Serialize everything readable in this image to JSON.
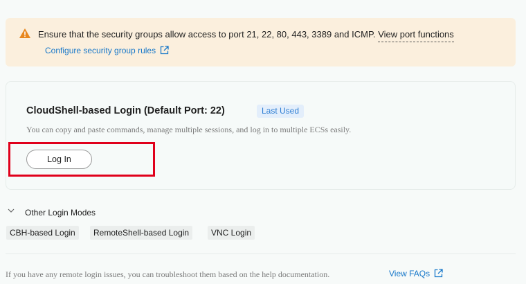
{
  "warning": {
    "text": "Ensure that the security groups allow access to port 21, 22, 80, 443, 3389 and ICMP.",
    "link": "View port functions",
    "config_link": "Configure security group rules"
  },
  "cloudshell": {
    "title": "CloudShell-based Login (Default Port: 22)",
    "badge": "Last Used",
    "description": "You can copy and paste commands, manage multiple sessions, and log in to multiple ECSs easily.",
    "login_button": "Log In"
  },
  "other_modes": {
    "title": "Other Login Modes",
    "items": [
      "CBH-based Login",
      "RemoteShell-based Login",
      "VNC Login"
    ]
  },
  "footer": {
    "text": "If you have any remote login issues, you can troubleshoot them based on the help documentation.",
    "faq_link": "View FAQs"
  },
  "colors": {
    "accent": "#1677c9",
    "warning_bg": "#fbefdd",
    "warning_icon": "#e8871e",
    "highlight": "#e0001b"
  }
}
